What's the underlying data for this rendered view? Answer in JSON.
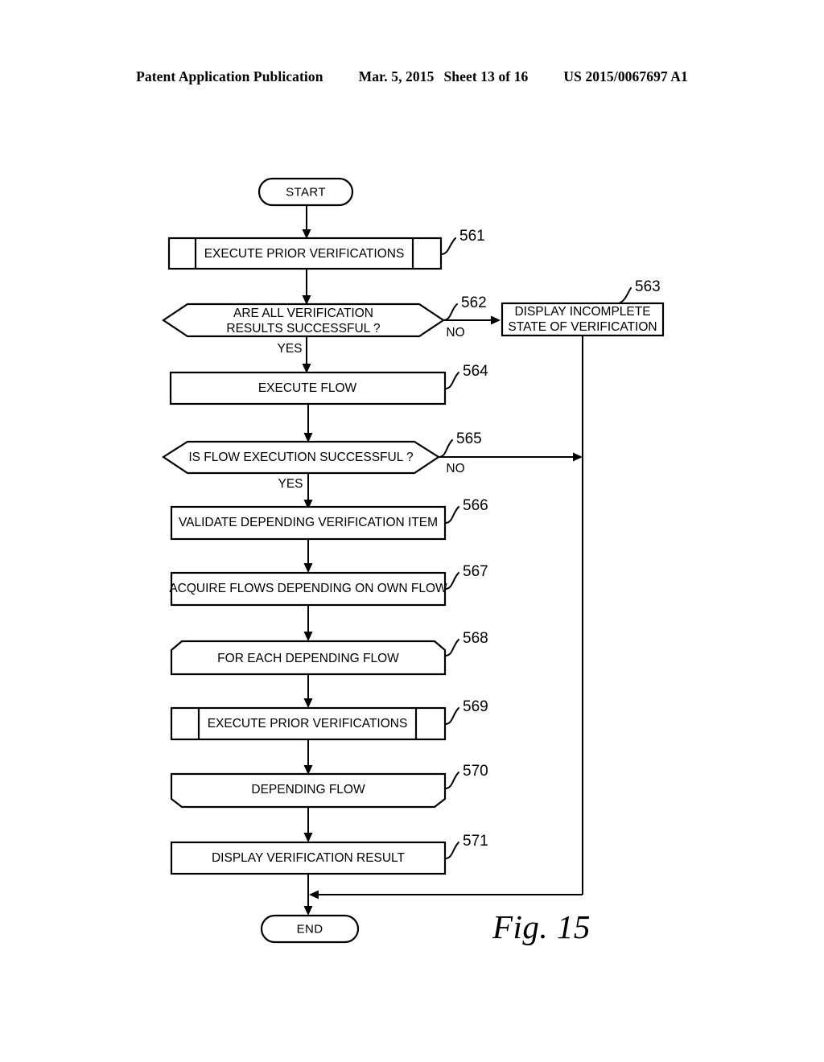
{
  "header": {
    "publication": "Patent Application Publication",
    "date": "Mar. 5, 2015",
    "sheet": "Sheet 13 of 16",
    "patent_number": "US 2015/0067697 A1"
  },
  "figure": {
    "caption": "Fig. 15"
  },
  "flowchart": {
    "start": {
      "label": "START"
    },
    "end": {
      "label": "END"
    },
    "nodes": [
      {
        "ref": "561",
        "label": "EXECUTE PRIOR VERIFICATIONS",
        "shape": "subroutine"
      },
      {
        "ref": "562",
        "label_line1": "ARE ALL VERIFICATION",
        "label_line2": "RESULTS SUCCESSFUL ?",
        "shape": "decision"
      },
      {
        "ref": "563",
        "label_line1": "DISPLAY INCOMPLETE",
        "label_line2": "STATE OF VERIFICATION",
        "shape": "process"
      },
      {
        "ref": "564",
        "label": "EXECUTE FLOW",
        "shape": "process"
      },
      {
        "ref": "565",
        "label": "IS FLOW EXECUTION SUCCESSFUL ?",
        "shape": "decision"
      },
      {
        "ref": "566",
        "label": "VALIDATE DEPENDING VERIFICATION ITEM",
        "shape": "process"
      },
      {
        "ref": "567",
        "label": "ACQUIRE FLOWS DEPENDING ON OWN FLOW",
        "shape": "process"
      },
      {
        "ref": "568",
        "label": "FOR EACH DEPENDING FLOW",
        "shape": "loop-start"
      },
      {
        "ref": "569",
        "label": "EXECUTE PRIOR VERIFICATIONS",
        "shape": "subroutine"
      },
      {
        "ref": "570",
        "label": "DEPENDING FLOW",
        "shape": "loop-end"
      },
      {
        "ref": "571",
        "label": "DISPLAY VERIFICATION RESULT",
        "shape": "process"
      }
    ],
    "branch_labels": {
      "yes_562": "YES",
      "no_562": "NO",
      "yes_565": "YES",
      "no_565": "NO"
    }
  },
  "colors": {
    "ink": "#000000",
    "paper": "#ffffff"
  }
}
